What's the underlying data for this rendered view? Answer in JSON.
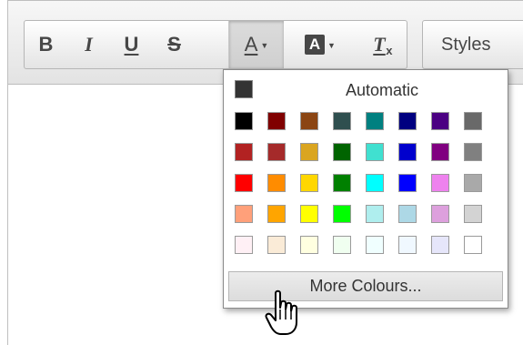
{
  "toolbar": {
    "buttons": [
      {
        "id": "bold",
        "glyph": "B",
        "icon": "bold-icon"
      },
      {
        "id": "italic",
        "glyph": "I",
        "icon": "italic-icon"
      },
      {
        "id": "underline",
        "glyph": "U",
        "icon": "underline-icon"
      },
      {
        "id": "strike",
        "glyph": "S",
        "icon": "strikethrough-icon"
      },
      {
        "id": "text-colour",
        "glyph": "A",
        "icon": "text-colour-icon",
        "pressed": true
      },
      {
        "id": "bg-colour",
        "glyph": "A",
        "icon": "background-colour-icon"
      },
      {
        "id": "remove-format",
        "glyph": "T",
        "icon": "remove-format-icon"
      }
    ],
    "styles_label": "Styles"
  },
  "colour_panel": {
    "automatic_label": "Automatic",
    "automatic_colour": "#333333",
    "more_colours_label": "More Colours...",
    "rows": [
      [
        "#000000",
        "#800000",
        "#8B4513",
        "#2F4F4F",
        "#008080",
        "#000080",
        "#4B0082",
        "#696969"
      ],
      [
        "#B22222",
        "#A52A2A",
        "#DAA520",
        "#006400",
        "#40E0D0",
        "#0000CD",
        "#800080",
        "#808080"
      ],
      [
        "#FF0000",
        "#FF8C00",
        "#FFD700",
        "#008000",
        "#00FFFF",
        "#0000FF",
        "#EE82EE",
        "#A9A9A9"
      ],
      [
        "#FFA07A",
        "#FFA500",
        "#FFFF00",
        "#00FF00",
        "#AFEEEE",
        "#ADD8E6",
        "#DDA0DD",
        "#D3D3D3"
      ],
      [
        "#FFF0F5",
        "#FAEBD7",
        "#FFFFE0",
        "#F0FFF0",
        "#F0FFFF",
        "#F0F8FF",
        "#E6E6FA",
        "#FFFFFF"
      ]
    ]
  },
  "colors": {
    "toolbar_bg": "#e8e8e8",
    "icon": "#474747"
  }
}
